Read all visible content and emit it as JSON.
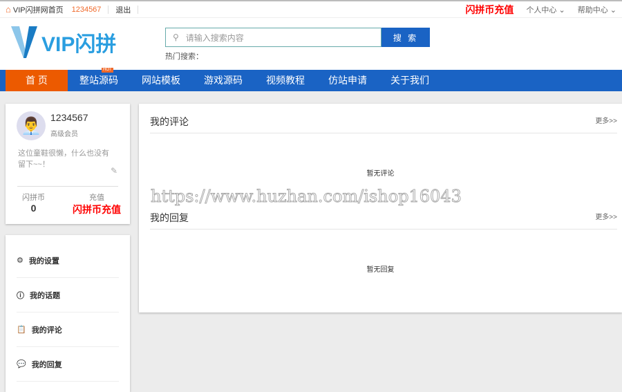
{
  "topbar": {
    "home": "VIP闪拼网首页",
    "user": "1234567",
    "logout": "退出",
    "recharge": "闪拼币充值",
    "personal": "个人中心",
    "help": "帮助中心"
  },
  "header": {
    "logo": "VIP闪拼",
    "search_placeholder": "请输入搜索内容",
    "search_btn": "搜 索",
    "hot_label": "热门搜索："
  },
  "nav": {
    "items": [
      "首 页",
      "整站源码",
      "网站模板",
      "游戏源码",
      "视频教程",
      "仿站申请",
      "关于我们"
    ],
    "hot_badge": "HOT"
  },
  "profile": {
    "name": "1234567",
    "level": "高级会员",
    "bio": "这位童鞋很懒，什么也没有留下~~！",
    "coin_label": "闪拼币",
    "coin_value": "0",
    "recharge_label": "充值",
    "recharge_link": "闪拼币充值"
  },
  "menu": [
    "我的设置",
    "我的话题",
    "我的评论",
    "我的回复"
  ],
  "main": {
    "comments_title": "我的评论",
    "comments_empty": "暂无评论",
    "replies_title": "我的回复",
    "replies_empty": "暂无回复",
    "more": "更多>>"
  },
  "watermark": "https://www.huzhan.com/ishop16043"
}
